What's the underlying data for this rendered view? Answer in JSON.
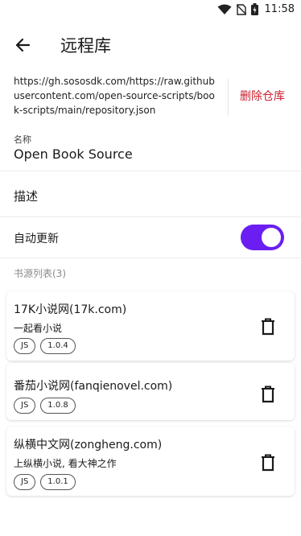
{
  "status_bar": {
    "time": "11:58",
    "icons": [
      "wifi-icon",
      "sim-off-icon",
      "battery-charging-icon"
    ]
  },
  "app_bar": {
    "title": "远程库",
    "back_icon": "arrow-left-icon"
  },
  "repository": {
    "url": "https://gh.sososdk.com/https://raw.githubusercontent.com/open-source-scripts/book-scripts/main/repository.json",
    "delete_label": "删除仓库"
  },
  "name_field": {
    "label": "名称",
    "value": "Open Book Source"
  },
  "description": {
    "label": "描述"
  },
  "auto_update": {
    "label": "自动更新",
    "enabled": true
  },
  "sources_header": "书源列表(3)",
  "sources": [
    {
      "title": "17K小说网(17k.com)",
      "subtitle": "一起看小说",
      "tags": [
        "JS",
        "1.0.4"
      ]
    },
    {
      "title": "番茄小说网(fanqienovel.com)",
      "subtitle": "",
      "tags": [
        "JS",
        "1.0.8"
      ]
    },
    {
      "title": "纵横中文网(zongheng.com)",
      "subtitle": "上纵横小说, 看大神之作",
      "tags": [
        "JS",
        "1.0.1"
      ]
    }
  ],
  "colors": {
    "accent": "#6a1ef2",
    "danger": "#c8202e"
  }
}
